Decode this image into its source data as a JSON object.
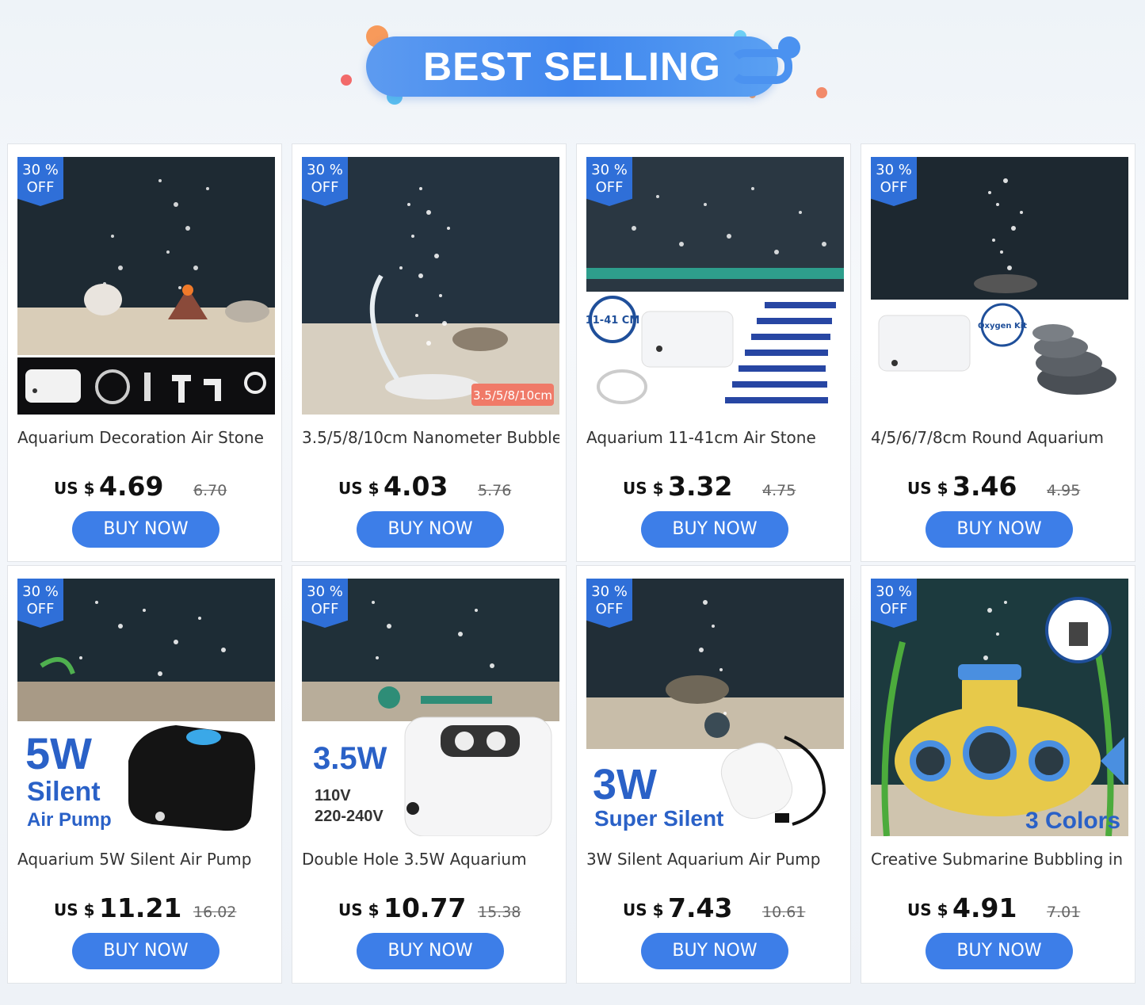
{
  "banner": {
    "title": "BEST SELLING"
  },
  "badge": {
    "percent": "30 %",
    "off": "OFF"
  },
  "currency": "US $",
  "buy_label": "BUY NOW",
  "products": [
    {
      "title": "Aquarium Decoration Air Stone",
      "price": "4.69",
      "original": "6.70",
      "image": "aquarium-air-stone-kit"
    },
    {
      "title": "3.5/5/8/10cm Nanometer Bubble",
      "price": "4.03",
      "original": "5.76",
      "image": "nanometer-bubble-stone",
      "image_label": "3.5/5/8/10cm"
    },
    {
      "title": "Aquarium 11-41cm Air Stone",
      "price": "3.32",
      "original": "4.75",
      "image": "air-stone-bar-kit",
      "image_label": "11-41 CM"
    },
    {
      "title": "4/5/6/7/8cm Round Aquarium",
      "price": "3.46",
      "original": "4.95",
      "image": "round-air-stone-kit",
      "image_label": "Oxygen Kit"
    },
    {
      "title": "Aquarium 5W Silent Air Pump",
      "price": "11.21",
      "original": "16.02",
      "image": "5w-air-pump",
      "image_label_1": "5W",
      "image_label_2": "Silent",
      "image_label_3": "Air Pump"
    },
    {
      "title": "Double Hole 3.5W Aquarium",
      "price": "10.77",
      "original": "15.38",
      "image": "3.5w-air-pump",
      "image_label_1": "3.5W",
      "image_label_2": "110V",
      "image_label_3": "220-240V"
    },
    {
      "title": "3W Silent Aquarium Air Pump",
      "price": "7.43",
      "original": "10.61",
      "image": "3w-air-pump",
      "image_label_1": "3W",
      "image_label_2": "Super Silent"
    },
    {
      "title": "Creative Submarine Bubbling in",
      "price": "4.91",
      "original": "7.01",
      "image": "submarine-ornament",
      "image_label": "3 Colors"
    }
  ],
  "colors": {
    "accent": "#3d7ee8",
    "badge": "#2f6fd8",
    "banner": "#4b8ff0"
  }
}
